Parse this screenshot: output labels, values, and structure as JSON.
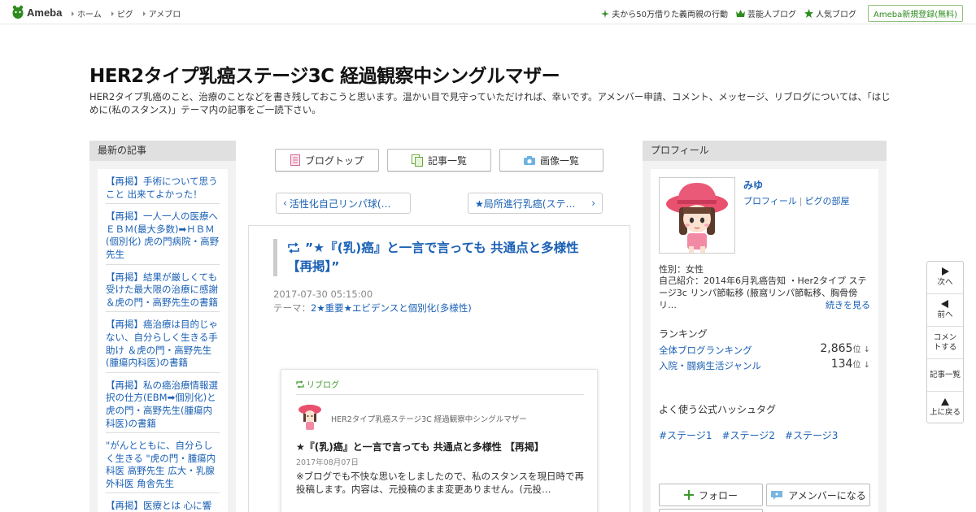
{
  "topbar": {
    "logo_text": "Ameba",
    "nav": [
      "ホーム",
      "ピグ",
      "アメブロ"
    ],
    "right_links": [
      {
        "label": "夫から50万借りた義両親の行動",
        "icon": "sparkle-icon"
      },
      {
        "label": "芸能人ブログ",
        "icon": "crown-icon"
      },
      {
        "label": "人気ブログ",
        "icon": "star-icon"
      }
    ],
    "register_label": "Ameba新規登録(無料)"
  },
  "blog": {
    "title": "HER2タイプ乳癌ステージ3C 経過観察中シングルマザー",
    "description": "HER2タイプ乳癌のこと、治療のことなどを書き残しておこうと思います。温かい目で見守っていただければ、幸いです。アメンバー申請、コメント、メッセージ、リブログについては、「はじめに(私のスタンス)」テーマ内の記事をご一読下さい。"
  },
  "left_sidebar": {
    "header": "最新の記事",
    "recent": [
      "【再掲】手術について思うこと 出来てよかった！",
      "【再掲】一人一人の医療へ ＥＢＭ(最大多数)➡ＨＢＭ(個別化) 虎の門病院・高野先生",
      "【再掲】結果が厳しくても受けた最大限の治療に感謝 ＆虎の門・高野先生の書籍",
      "【再掲】癌治療は目的じゃない、自分らしく生きる手助け ＆虎の門・高野先生(腫瘍内科医)の書籍",
      "【再掲】私の癌治療情報選択の仕方(EBM➡個別化)と虎の門・高野先生(腫瘍内科医)の書籍",
      "\"がんとともに、自分らしく生きる \"虎の門・腫瘍内科医 高野先生 広大・乳腺外科医 角舎先生",
      "【再掲】医療とは 心に響"
    ]
  },
  "center": {
    "buttons": [
      {
        "label": "ブログトップ",
        "icon": "document-icon"
      },
      {
        "label": "記事一覧",
        "icon": "copy-icon"
      },
      {
        "label": "画像一覧",
        "icon": "camera-icon"
      }
    ],
    "prev_label": "活性化自己リンパ球(…",
    "next_label": "★局所進行乳癌(ステ…",
    "article": {
      "title": "”★『(乳)癌』と一言で言っても 共通点と多様性 【再掲】”",
      "date": "2017-07-30 05:15:00",
      "theme_prefix": "テーマ：",
      "theme": "2★重要★エビデンスと個別化(多様性)"
    },
    "reblog": {
      "label": "リブログ",
      "blog_name": "HER2タイプ乳癌ステージ3C 経過観察中シングルマザー",
      "title": "★『(乳)癌』と一言で言っても 共通点と多様性 【再掲】",
      "date": "2017年08月07日",
      "text": "※ブログでも不快な思いをしましたので、私のスタンスを現日時で再投稿します。内容は、元投稿のまま変更ありません。(元投…"
    }
  },
  "right_sidebar": {
    "header": "プロフィール",
    "name": "みゆ",
    "link_profile": "プロフィール",
    "link_room": "ピグの部屋",
    "gender": "性別：女性",
    "intro": "自己紹介：2014年6月乳癌告知 ・Her2タイプ ステージ3c リンパ節転移 (腋窩リンパ節転移、胸骨傍リ…",
    "more": "続きを見る",
    "ranking_header": "ランキング",
    "rankings": [
      {
        "label": "全体ブログランキング",
        "value": "2,865",
        "unit": "位 ↓"
      },
      {
        "label": "入院・闘病生活ジャンル",
        "value": "134",
        "unit": "位 ↓"
      }
    ],
    "hashtag_header": "よく使う公式ハッシュタグ",
    "hashtags": [
      "#ステージ1",
      "#ステージ2",
      "#ステージ3"
    ],
    "follow_label": "フォロー",
    "member_label": "アメンバーになる"
  },
  "float_nav": [
    {
      "label": "次へ",
      "icon": "play-icon"
    },
    {
      "label": "前へ",
      "icon": "back-icon"
    },
    {
      "label": "コメントする",
      "icon": ""
    },
    {
      "label": "記事一覧",
      "icon": ""
    },
    {
      "label": "上に戻る",
      "icon": "up-icon"
    }
  ],
  "colors": {
    "link": "#1a60b5",
    "green": "#3d9a2d",
    "sidebar_bg": "#f2f2f2"
  }
}
